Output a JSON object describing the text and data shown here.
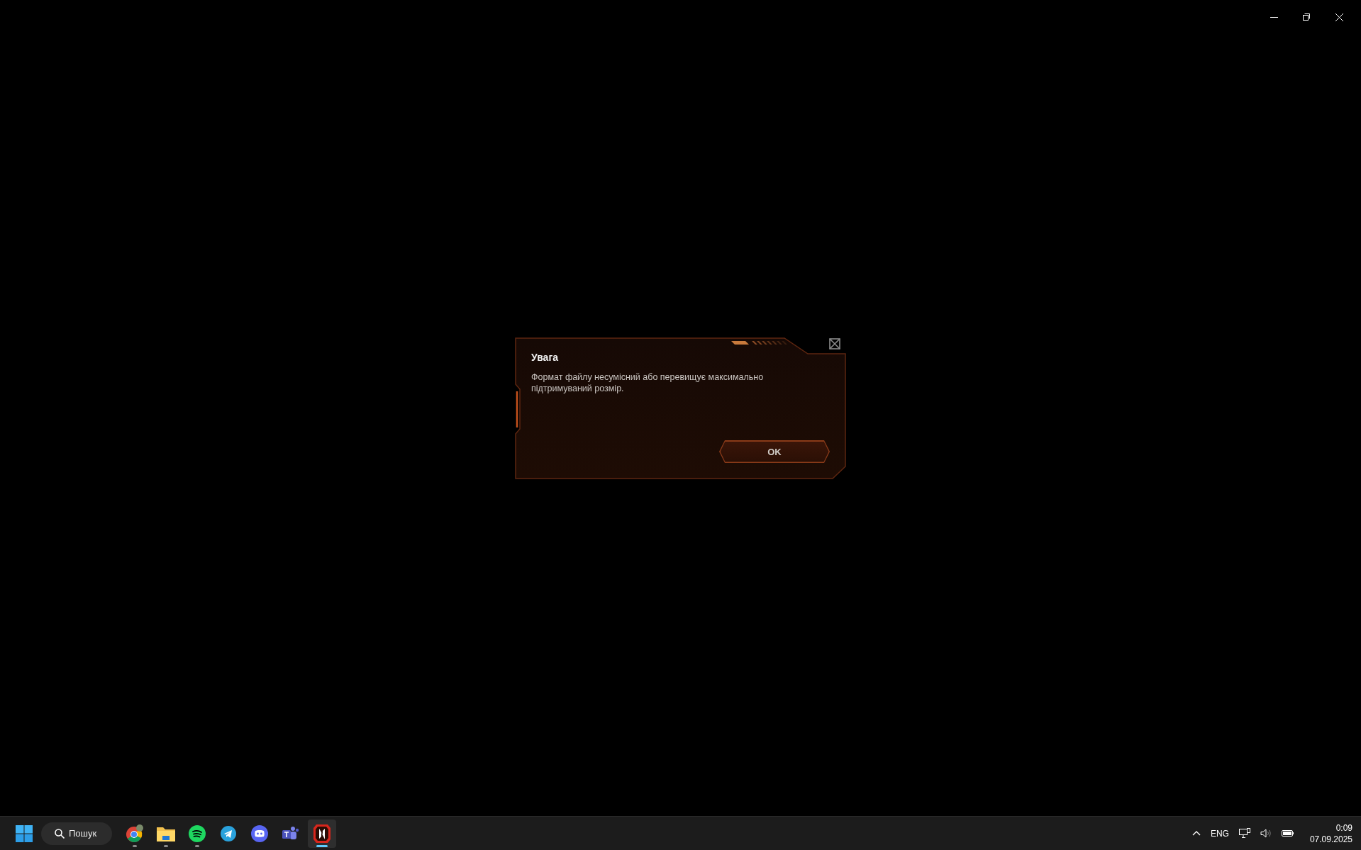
{
  "window_controls": [
    {
      "kind": "minimize"
    },
    {
      "kind": "restore"
    },
    {
      "kind": "close"
    }
  ],
  "dialog": {
    "title": "Увага",
    "message": "Формат файлу несумісний або перевищує максимально підтримуваний розмір.",
    "button": "OK"
  },
  "taskbar": {
    "search": {
      "placeholder": "Пошук"
    },
    "apps": [
      {
        "kind": "browser",
        "running": true,
        "selected": false
      },
      {
        "kind": "folder",
        "running": true,
        "selected": false
      },
      {
        "kind": "music",
        "running": true,
        "selected": false
      },
      {
        "kind": "messenger",
        "running": false,
        "selected": false
      },
      {
        "kind": "chat",
        "running": false,
        "selected": false
      },
      {
        "kind": "teams",
        "running": false,
        "selected": false
      },
      {
        "kind": "game",
        "running": true,
        "selected": true
      }
    ],
    "language": "ENG",
    "time": "0:09",
    "date": "07.09.2025"
  }
}
